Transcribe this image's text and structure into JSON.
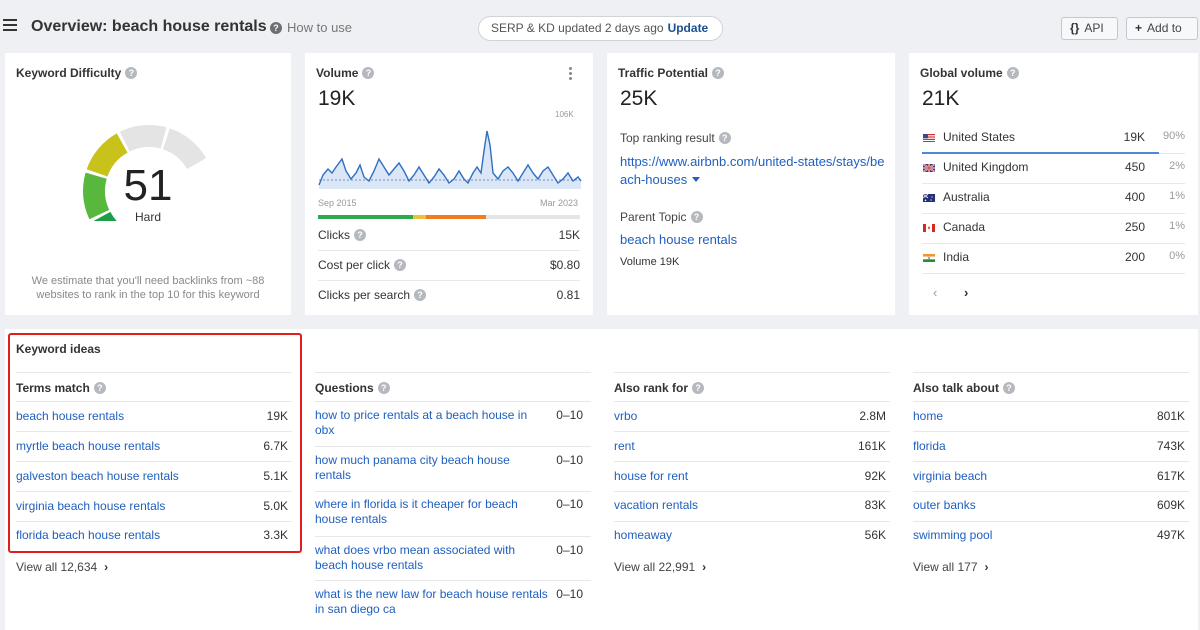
{
  "header": {
    "title": "Overview: beach house rentals",
    "how_to_use": "How to use",
    "serp_status": "SERP & KD updated 2 days ago",
    "update_label": "Update",
    "api_label": "API",
    "add_to_label": "Add to"
  },
  "keyword_difficulty": {
    "title": "Keyword Difficulty",
    "value": "51",
    "score": 51,
    "rating": "Hard",
    "note": "We estimate that you'll need backlinks from ~88 websites to rank in the top 10 for this keyword"
  },
  "volume": {
    "title": "Volume",
    "value": "19K",
    "chart_max_label": "106K",
    "chart_start_label": "Sep 2015",
    "chart_end_label": "Mar 2023",
    "metrics": [
      {
        "label": "Clicks",
        "value": "15K"
      },
      {
        "label": "Cost per click",
        "value": "$0.80"
      },
      {
        "label": "Clicks per search",
        "value": "0.81"
      }
    ],
    "colors": {
      "green": "#2daa4d",
      "yellow": "#e8c33a",
      "orange": "#ef7d22"
    }
  },
  "traffic_potential": {
    "title": "Traffic Potential",
    "value": "25K",
    "top_ranking_label": "Top ranking result",
    "top_ranking_url": "https://www.airbnb.com/united-states/stays/beach-houses",
    "parent_topic_label": "Parent Topic",
    "parent_topic": "beach house rentals",
    "parent_volume": "Volume 19K"
  },
  "global_volume": {
    "title": "Global volume",
    "value": "21K",
    "countries": [
      {
        "name": "United States",
        "volume": "19K",
        "share": "90%",
        "share_fraction": 0.9,
        "flag": "us-flag-icon"
      },
      {
        "name": "United Kingdom",
        "volume": "450",
        "share": "2%",
        "share_fraction": 0.02,
        "flag": "uk-flag-icon"
      },
      {
        "name": "Australia",
        "volume": "400",
        "share": "1%",
        "share_fraction": 0.01,
        "flag": "au-flag-icon"
      },
      {
        "name": "Canada",
        "volume": "250",
        "share": "1%",
        "share_fraction": 0.01,
        "flag": "ca-flag-icon"
      },
      {
        "name": "India",
        "volume": "200",
        "share": "0%",
        "share_fraction": 0.0,
        "flag": "in-flag-icon"
      }
    ],
    "prev_label": "‹",
    "next_label": "›"
  },
  "keyword_ideas": {
    "title": "Keyword ideas",
    "columns": [
      {
        "header": "Terms match",
        "rows": [
          {
            "keyword": "beach house rentals",
            "value": "19K"
          },
          {
            "keyword": "myrtle beach house rentals",
            "value": "6.7K"
          },
          {
            "keyword": "galveston beach house rentals",
            "value": "5.1K"
          },
          {
            "keyword": "virginia beach house rentals",
            "value": "5.0K"
          },
          {
            "keyword": "florida beach house rentals",
            "value": "3.3K"
          }
        ],
        "view_all": "View all 12,634"
      },
      {
        "header": "Questions",
        "rows": [
          {
            "keyword": "how to price rentals at a beach house in obx",
            "value": "0–10"
          },
          {
            "keyword": "how much panama city beach house rentals",
            "value": "0–10"
          },
          {
            "keyword": "where in florida is it cheaper for beach house rentals",
            "value": "0–10"
          },
          {
            "keyword": "what does vrbo mean associated with beach house rentals",
            "value": "0–10"
          },
          {
            "keyword": "what is the new law for beach house rentals in san diego ca",
            "value": "0–10"
          }
        ]
      },
      {
        "header": "Also rank for",
        "rows": [
          {
            "keyword": "vrbo",
            "value": "2.8M"
          },
          {
            "keyword": "rent",
            "value": "161K"
          },
          {
            "keyword": "house for rent",
            "value": "92K"
          },
          {
            "keyword": "vacation rentals",
            "value": "83K"
          },
          {
            "keyword": "homeaway",
            "value": "56K"
          }
        ],
        "view_all": "View all 22,991"
      },
      {
        "header": "Also talk about",
        "rows": [
          {
            "keyword": "home",
            "value": "801K"
          },
          {
            "keyword": "florida",
            "value": "743K"
          },
          {
            "keyword": "virginia beach",
            "value": "617K"
          },
          {
            "keyword": "outer banks",
            "value": "609K"
          },
          {
            "keyword": "swimming pool",
            "value": "497K"
          }
        ],
        "view_all": "View all 177"
      }
    ]
  }
}
